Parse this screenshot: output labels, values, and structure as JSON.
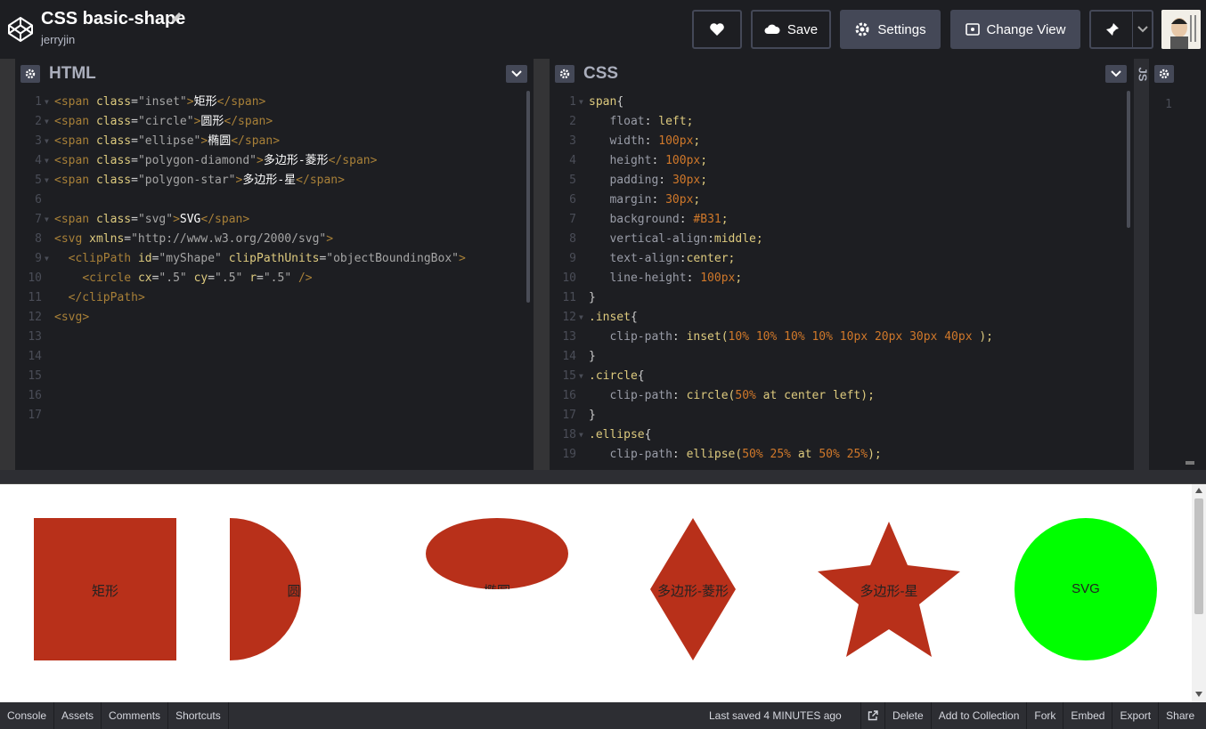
{
  "header": {
    "title": "CSS basic-shape",
    "author": "jerryjin",
    "buttons": {
      "save": "Save",
      "settings": "Settings",
      "change_view": "Change View"
    }
  },
  "panes": {
    "html": {
      "label": "HTML"
    },
    "css": {
      "label": "CSS"
    },
    "js": {
      "label": "JS",
      "line1": "1"
    }
  },
  "html_code": [
    [
      "<span class=\"inset\">",
      "矩形",
      "</span>"
    ],
    [
      "<span class=\"circle\">",
      "圆形",
      "</span>"
    ],
    [
      "<span class=\"ellipse\">",
      "椭圆",
      "</span>"
    ],
    [
      "<span class=\"polygon-diamond\">",
      "多边形-菱形",
      "</span>"
    ],
    [
      "<span class=\"polygon-star\">",
      "多边形-星",
      "</span>"
    ],
    [
      "",
      "",
      ""
    ],
    [
      "<span class=\"svg\">",
      "SVG",
      "</span>"
    ],
    [
      "<svg xmlns=\"http://www.w3.org/2000/svg\">",
      "",
      ""
    ],
    [
      "  <clipPath id=\"myShape\" clipPathUnits=\"objectBoundingBox\">",
      "",
      ""
    ],
    [
      "    <circle cx=\".5\" cy=\".5\" r=\".5\" />",
      "",
      ""
    ],
    [
      "  </clipPath>",
      "",
      ""
    ],
    [
      "<svg>",
      "",
      ""
    ],
    [
      "",
      "",
      ""
    ],
    [
      "",
      "",
      ""
    ],
    [
      "",
      "",
      ""
    ],
    [
      "",
      "",
      ""
    ],
    [
      "",
      "",
      ""
    ]
  ],
  "css_code": [
    "span{",
    "   float: left;",
    "   width: 100px;",
    "   height: 100px;",
    "   padding: 30px;",
    "   margin: 30px;",
    "   background: #B31;",
    "   vertical-align:middle;",
    "   text-align:center;",
    "   line-height: 100px;",
    "}",
    ".inset{",
    "   clip-path: inset(10% 10% 10% 10% 10px 20px 30px 40px );",
    "}",
    ".circle{",
    "   clip-path: circle(50% at center left);",
    "}",
    ".ellipse{",
    "   clip-path: ellipse(50% 25% at 50% 25%);"
  ],
  "preview": {
    "shapes": [
      "矩形",
      "圆",
      "椭圆",
      "多边形-菱形",
      "多边形-星",
      "SVG"
    ],
    "shape_color": "#B8301A",
    "svg_color": "#00FF00"
  },
  "footer": {
    "left": [
      "Console",
      "Assets",
      "Comments",
      "Shortcuts"
    ],
    "saved": "Last saved 4 MINUTES ago",
    "right": [
      "Delete",
      "Add to Collection",
      "Fork",
      "Embed",
      "Export",
      "Share"
    ]
  }
}
